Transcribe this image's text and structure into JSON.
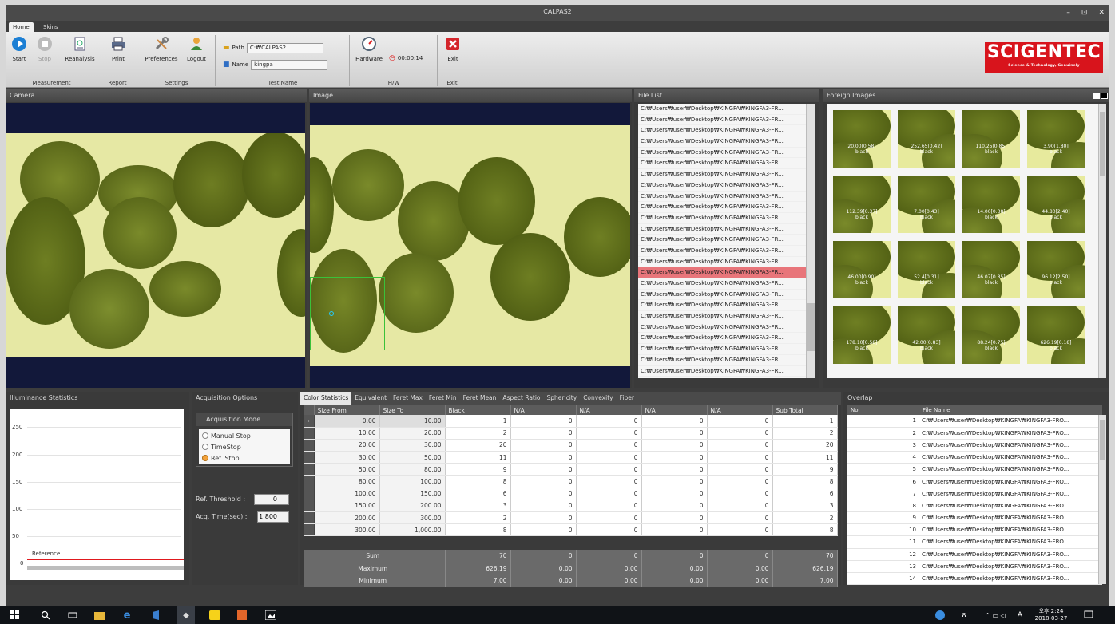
{
  "window": {
    "title": "CALPAS2",
    "minimize": "–",
    "restore": "⊡",
    "close": "✕"
  },
  "ribbon_tabs": [
    "Home",
    "Skins"
  ],
  "ribbon": {
    "start": "Start",
    "stop": "Stop",
    "reanalysis": "Reanalysis",
    "print": "Print",
    "preferences": "Preferences",
    "logout": "Logout",
    "path_label": "Path",
    "path_value": "C:₩CALPAS2",
    "name_label": "Name",
    "name_value": "kingpa",
    "hardware": "Hardware",
    "timer": "00:00:14",
    "exit": "Exit",
    "groups": {
      "measurement": "Measurement",
      "report": "Report",
      "settings": "Settings",
      "test_name": "Test Name",
      "hw": "H/W",
      "exit": "Exit"
    }
  },
  "logo": {
    "name": "SCIGENTEC",
    "tagline": "Science & Technology, Genuinely"
  },
  "panels": {
    "camera": "Camera",
    "image": "Image",
    "file_list": "File List",
    "foreign_images": "Foreign Images",
    "illuminance": "Illuminance Statistics",
    "acq_options": "Acquisition Options",
    "overlap": "Overlap"
  },
  "file_list": {
    "items": [
      "C:₩Users₩user₩Desktop₩KINGFA₩KINGFA3-FR...",
      "C:₩Users₩user₩Desktop₩KINGFA₩KINGFA3-FR...",
      "C:₩Users₩user₩Desktop₩KINGFA₩KINGFA3-FR...",
      "C:₩Users₩user₩Desktop₩KINGFA₩KINGFA3-FR...",
      "C:₩Users₩user₩Desktop₩KINGFA₩KINGFA3-FR...",
      "C:₩Users₩user₩Desktop₩KINGFA₩KINGFA3-FR...",
      "C:₩Users₩user₩Desktop₩KINGFA₩KINGFA3-FR...",
      "C:₩Users₩user₩Desktop₩KINGFA₩KINGFA3-FR...",
      "C:₩Users₩user₩Desktop₩KINGFA₩KINGFA3-FR...",
      "C:₩Users₩user₩Desktop₩KINGFA₩KINGFA3-FR...",
      "C:₩Users₩user₩Desktop₩KINGFA₩KINGFA3-FR...",
      "C:₩Users₩user₩Desktop₩KINGFA₩KINGFA3-FR...",
      "C:₩Users₩user₩Desktop₩KINGFA₩KINGFA3-FR...",
      "C:₩Users₩user₩Desktop₩KINGFA₩KINGFA3-FR...",
      "C:₩Users₩user₩Desktop₩KINGFA₩KINGFA3-FR...",
      "C:₩Users₩user₩Desktop₩KINGFA₩KINGFA3-FR...",
      "C:₩Users₩user₩Desktop₩KINGFA₩KINGFA3-FR...",
      "C:₩Users₩user₩Desktop₩KINGFA₩KINGFA3-FR...",
      "C:₩Users₩user₩Desktop₩KINGFA₩KINGFA3-FR...",
      "C:₩Users₩user₩Desktop₩KINGFA₩KINGFA3-FR...",
      "C:₩Users₩user₩Desktop₩KINGFA₩KINGFA3-FR...",
      "C:₩Users₩user₩Desktop₩KINGFA₩KINGFA3-FR...",
      "C:₩Users₩user₩Desktop₩KINGFA₩KINGFA3-FR...",
      "C:₩Users₩user₩Desktop₩KINGFA₩KINGFA3-FR...",
      "C:₩Users₩user₩Desktop₩KINGFA₩KINGFA3-FR..."
    ],
    "selected_index": 15
  },
  "foreign_images": [
    {
      "label": "20.00[0.58]",
      "sub": "black"
    },
    {
      "label": "252.65[0.42]",
      "sub": "black"
    },
    {
      "label": "110.25[0.85]",
      "sub": "black"
    },
    {
      "label": "3.90[1.80]",
      "sub": "black"
    },
    {
      "label": "112.39[0.37]",
      "sub": "black"
    },
    {
      "label": "7.00[0.43]",
      "sub": "black"
    },
    {
      "label": "14.00[0.38]",
      "sub": "black"
    },
    {
      "label": "44.80[2.40]",
      "sub": "black"
    },
    {
      "label": "46.00[0.90]",
      "sub": "black"
    },
    {
      "label": "52.4[0.31]",
      "sub": "black"
    },
    {
      "label": "46.07[0.85]",
      "sub": "black"
    },
    {
      "label": "96.12[2.50]",
      "sub": "black"
    },
    {
      "label": "178.10[0.58]",
      "sub": "black"
    },
    {
      "label": "42.00[0.83]",
      "sub": "black"
    },
    {
      "label": "88.24[0.75]",
      "sub": "black"
    },
    {
      "label": "626.19[0.18]",
      "sub": "black"
    }
  ],
  "illuminance": {
    "y_ticks": [
      "250",
      "200",
      "150",
      "100",
      "50",
      "0"
    ],
    "reference_label": "Reference"
  },
  "acquisition": {
    "mode_title": "Acquisition Mode",
    "options": [
      "Manual Stop",
      "TimeStop",
      "Ref. Stop"
    ],
    "selected": 2,
    "ref_threshold_label": "Ref. Threshold :",
    "ref_threshold_value": "0",
    "acq_time_label": "Acq. Time(sec) :",
    "acq_time_value": "1,800"
  },
  "stats_tabs": [
    "Color Statistics",
    "Equivalent",
    "Feret Max",
    "Feret Min",
    "Feret Mean",
    "Aspect Ratio",
    "Sphericity",
    "Convexity",
    "Fiber"
  ],
  "stats_table": {
    "headers": [
      "Size From",
      "Size To",
      "Black",
      "N/A",
      "N/A",
      "N/A",
      "N/A",
      "Sub Total"
    ],
    "rows": [
      [
        "0.00",
        "10.00",
        "1",
        "0",
        "0",
        "0",
        "0",
        "1"
      ],
      [
        "10.00",
        "20.00",
        "2",
        "0",
        "0",
        "0",
        "0",
        "2"
      ],
      [
        "20.00",
        "30.00",
        "20",
        "0",
        "0",
        "0",
        "0",
        "20"
      ],
      [
        "30.00",
        "50.00",
        "11",
        "0",
        "0",
        "0",
        "0",
        "11"
      ],
      [
        "50.00",
        "80.00",
        "9",
        "0",
        "0",
        "0",
        "0",
        "9"
      ],
      [
        "80.00",
        "100.00",
        "8",
        "0",
        "0",
        "0",
        "0",
        "8"
      ],
      [
        "100.00",
        "150.00",
        "6",
        "0",
        "0",
        "0",
        "0",
        "6"
      ],
      [
        "150.00",
        "200.00",
        "3",
        "0",
        "0",
        "0",
        "0",
        "3"
      ],
      [
        "200.00",
        "300.00",
        "2",
        "0",
        "0",
        "0",
        "0",
        "2"
      ],
      [
        "300.00",
        "1,000.00",
        "8",
        "0",
        "0",
        "0",
        "0",
        "8"
      ]
    ],
    "summary": [
      [
        "Sum",
        "70",
        "0",
        "0",
        "0",
        "0",
        "70"
      ],
      [
        "Maximum",
        "626.19",
        "0.00",
        "0.00",
        "0.00",
        "0.00",
        "626.19"
      ],
      [
        "Minimum",
        "7.00",
        "0.00",
        "0.00",
        "0.00",
        "0.00",
        "7.00"
      ]
    ]
  },
  "overlap": {
    "headers": [
      "No",
      "File Name"
    ],
    "rows": [
      [
        "1",
        "C:₩Users₩user₩Desktop₩KINGFA₩KINGFA3-FRO..."
      ],
      [
        "2",
        "C:₩Users₩user₩Desktop₩KINGFA₩KINGFA3-FRO..."
      ],
      [
        "3",
        "C:₩Users₩user₩Desktop₩KINGFA₩KINGFA3-FRO..."
      ],
      [
        "4",
        "C:₩Users₩user₩Desktop₩KINGFA₩KINGFA3-FRO..."
      ],
      [
        "5",
        "C:₩Users₩user₩Desktop₩KINGFA₩KINGFA3-FRO..."
      ],
      [
        "6",
        "C:₩Users₩user₩Desktop₩KINGFA₩KINGFA3-FRO..."
      ],
      [
        "7",
        "C:₩Users₩user₩Desktop₩KINGFA₩KINGFA3-FRO..."
      ],
      [
        "8",
        "C:₩Users₩user₩Desktop₩KINGFA₩KINGFA3-FRO..."
      ],
      [
        "9",
        "C:₩Users₩user₩Desktop₩KINGFA₩KINGFA3-FRO..."
      ],
      [
        "10",
        "C:₩Users₩user₩Desktop₩KINGFA₩KINGFA3-FRO..."
      ],
      [
        "11",
        "C:₩Users₩user₩Desktop₩KINGFA₩KINGFA3-FRO..."
      ],
      [
        "12",
        "C:₩Users₩user₩Desktop₩KINGFA₩KINGFA3-FRO..."
      ],
      [
        "13",
        "C:₩Users₩user₩Desktop₩KINGFA₩KINGFA3-FRO..."
      ],
      [
        "14",
        "C:₩Users₩user₩Desktop₩KINGFA₩KINGFA3-FRO..."
      ]
    ]
  },
  "taskbar": {
    "clock_time": "오후 2:24",
    "clock_date": "2018-03-27",
    "ime": "A"
  },
  "colors": {
    "accent": "#d8141c",
    "selection": "#e8757a",
    "reference_line": "#e0191e",
    "pellet": "#6a7a1a",
    "background": "#e7ea9d"
  }
}
